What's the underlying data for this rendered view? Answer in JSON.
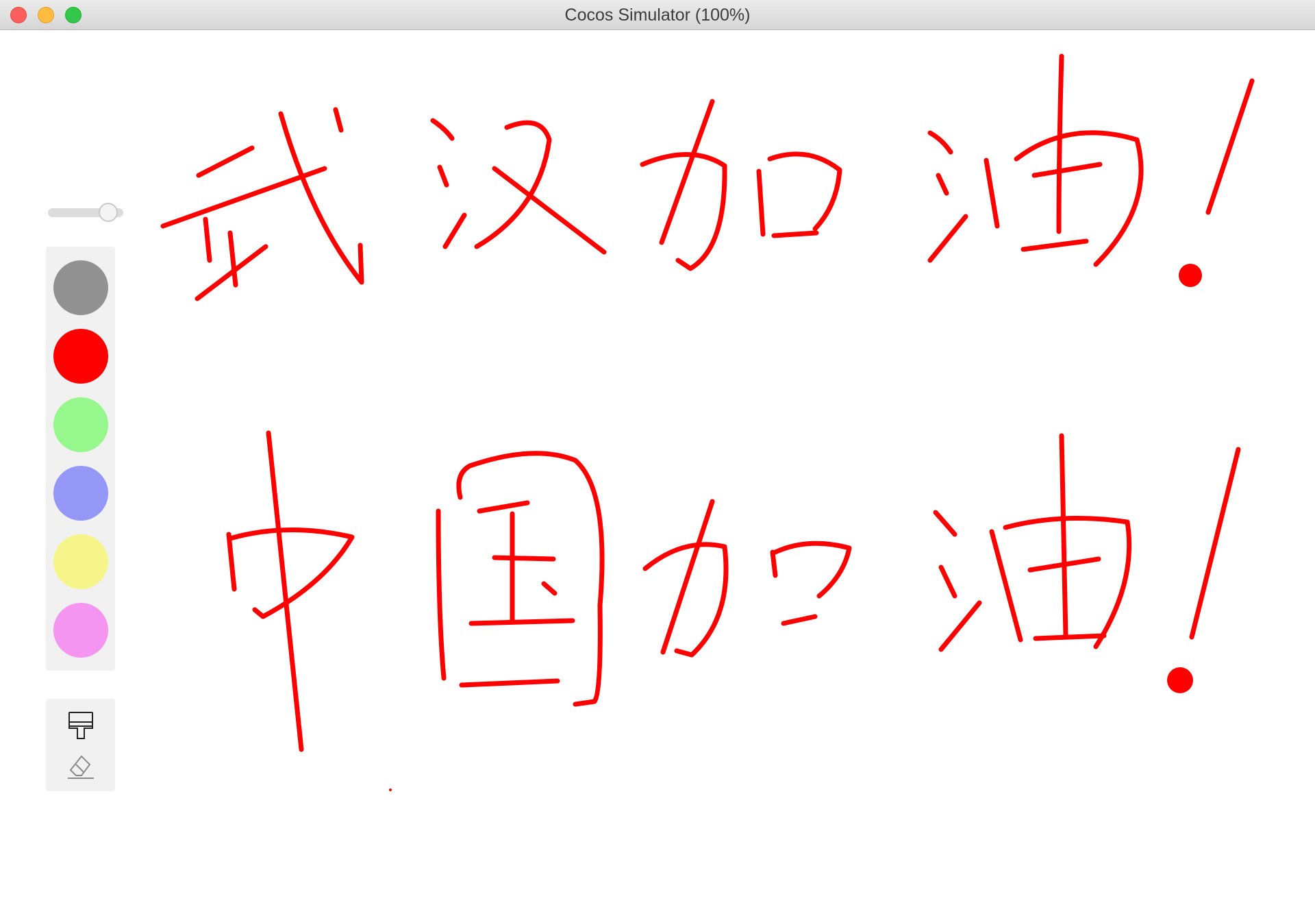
{
  "window": {
    "title": "Cocos Simulator (100%)"
  },
  "brush": {
    "size_level": 0.9
  },
  "palette": {
    "colors": [
      {
        "name": "gray",
        "color": "#919191"
      },
      {
        "name": "red",
        "color": "#ff0000"
      },
      {
        "name": "green",
        "color": "#96f78c"
      },
      {
        "name": "blue",
        "color": "#9597f6"
      },
      {
        "name": "yellow",
        "color": "#f5f58a"
      },
      {
        "name": "pink",
        "color": "#f595f2"
      }
    ],
    "selected": "red"
  },
  "tools": [
    {
      "name": "brush-icon",
      "label": ""
    },
    {
      "name": "eraser-icon",
      "label": ""
    }
  ],
  "canvas": {
    "stroke_color": "#ff0000",
    "lines": [
      "武汉加油!",
      "中国加油!"
    ]
  }
}
